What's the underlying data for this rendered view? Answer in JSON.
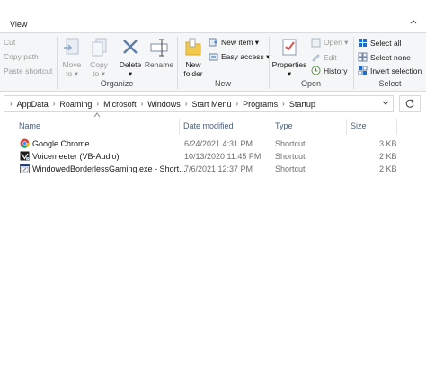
{
  "tabs": {
    "view": "View"
  },
  "ribbon": {
    "clipboard": {
      "cut": "Cut",
      "copy_path": "Copy path",
      "paste_shortcut": "Paste shortcut"
    },
    "organize": {
      "label": "Organize",
      "move_to": "Move\nto ▾",
      "copy_to": "Copy\nto ▾",
      "delete": "Delete\n▾",
      "rename": "Rename"
    },
    "new": {
      "label": "New",
      "new_folder": "New\nfolder",
      "new_item": "New item ▾",
      "easy_access": "Easy access ▾"
    },
    "open": {
      "label": "Open",
      "properties": "Properties\n▾",
      "open": "Open ▾",
      "edit": "Edit",
      "history": "History"
    },
    "select": {
      "label": "Select",
      "select_all": "Select all",
      "select_none": "Select none",
      "invert_selection": "Invert selection"
    }
  },
  "address": {
    "crumbs": [
      "AppData",
      "Roaming",
      "Microsoft",
      "Windows",
      "Start Menu",
      "Programs",
      "Startup"
    ]
  },
  "columns": {
    "name": "Name",
    "date": "Date modified",
    "type": "Type",
    "size": "Size"
  },
  "files": [
    {
      "name": "Google Chrome",
      "date": "6/24/2021 4:31 PM",
      "type": "Shortcut",
      "size": "3 KB",
      "icon": "chrome-icon"
    },
    {
      "name": "Voicemeeter (VB-Audio)",
      "date": "10/13/2020 11:45 PM",
      "type": "Shortcut",
      "size": "2 KB",
      "icon": "voicemeeter-icon"
    },
    {
      "name": "WindowedBorderlessGaming.exe - Short...",
      "date": "7/6/2021 12:37 PM",
      "type": "Shortcut",
      "size": "2 KB",
      "icon": "exe-icon"
    }
  ],
  "colors": {
    "accent_blue": "#1e6fc4",
    "header_text": "#4c607a",
    "chrome_red": "#db4437",
    "chrome_green": "#0f9d58",
    "chrome_yellow": "#f4b400"
  }
}
